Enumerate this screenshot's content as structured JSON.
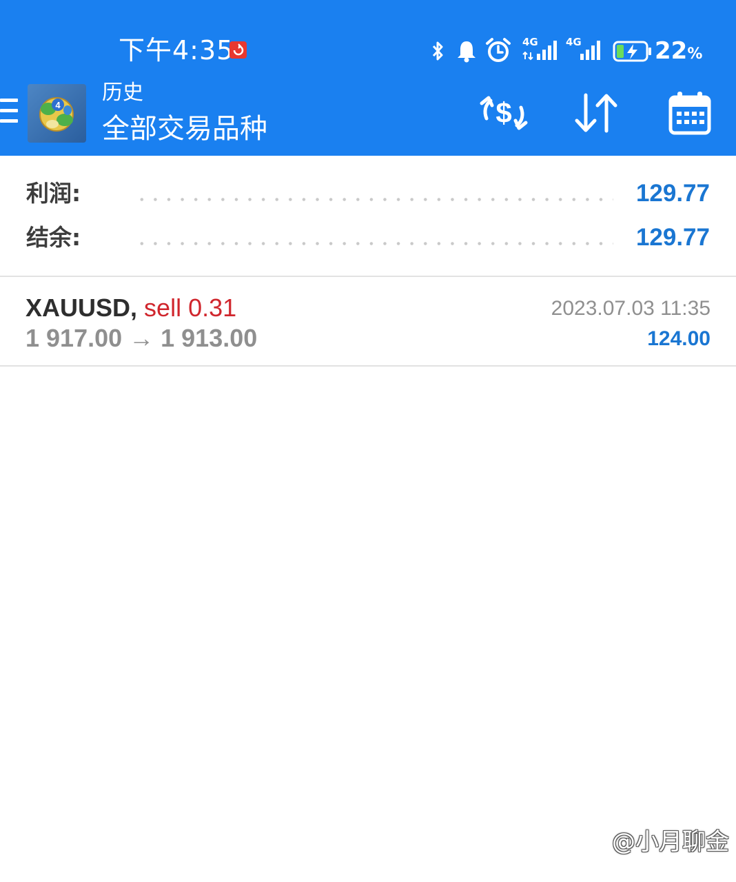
{
  "status_bar": {
    "time": "下午4:35",
    "battery_percent": "22",
    "battery_unit": "%",
    "signal_1_label": "4G",
    "signal_2_label": "4G",
    "icons": [
      "bluetooth-icon",
      "bell-icon",
      "alarm-icon",
      "signal-4g-icon",
      "signal-4g-icon",
      "battery-charging-icon"
    ]
  },
  "app_bar": {
    "subtitle": "历史",
    "title": "全部交易品种",
    "actions": [
      "currency-exchange-icon",
      "sort-icon",
      "calendar-icon"
    ]
  },
  "summary": {
    "profit_label": "利润:",
    "profit_value": "129.77",
    "balance_label": "结余:",
    "balance_value": "129.77"
  },
  "trades": [
    {
      "symbol": "XAUUSD",
      "separator": ",",
      "side": "sell 0.31",
      "prices": "1 917.00 → 1 913.00",
      "time": "2023.07.03 11:35",
      "profit": "124.00"
    }
  ],
  "watermark": "@小月聊金",
  "colors": {
    "app_bar": "#1a80f0",
    "value_blue": "#1a76d2",
    "sell_red": "#d0262d",
    "muted_gray": "#8f8f8f"
  }
}
